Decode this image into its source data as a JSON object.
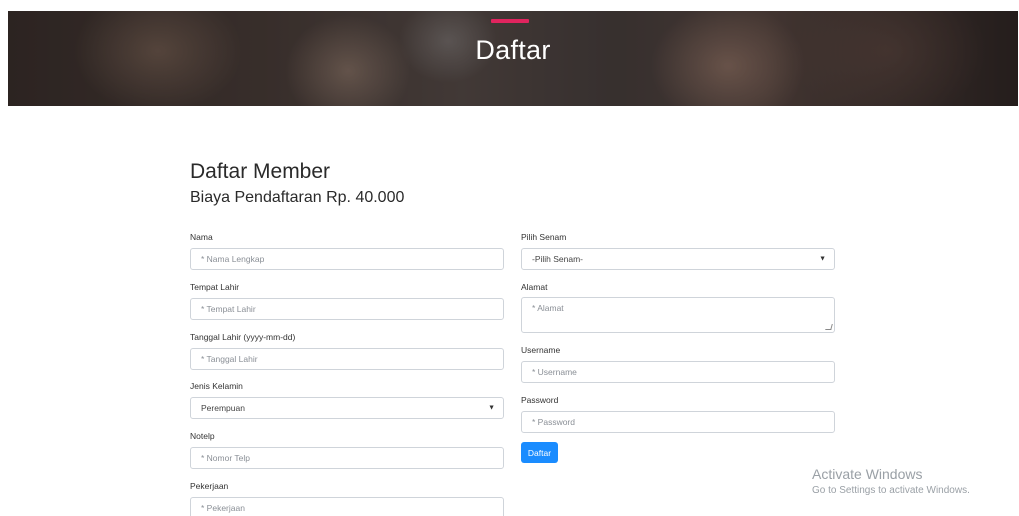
{
  "hero": {
    "title": "Daftar",
    "accent_color": "#e0245e"
  },
  "form": {
    "title": "Daftar Member",
    "subtitle": "Biaya Pendaftaran Rp. 40.000",
    "left_fields": {
      "nama": {
        "label": "Nama",
        "placeholder": "* Nama Lengkap"
      },
      "tempat_lahir": {
        "label": "Tempat Lahir",
        "placeholder": "* Tempat Lahir"
      },
      "tanggal_lahir": {
        "label": "Tanggal Lahir (yyyy-mm-dd)",
        "placeholder": "* Tanggal Lahir"
      },
      "jenis_kelamin": {
        "label": "Jenis Kelamin",
        "value": "Perempuan"
      },
      "notelp": {
        "label": "Notelp",
        "placeholder": "* Nomor Telp"
      },
      "pekerjaan": {
        "label": "Pekerjaan",
        "placeholder": "* Pekerjaan"
      }
    },
    "right_fields": {
      "senam": {
        "label": "Pilih Senam",
        "value": "-Pilih Senam-"
      },
      "alamat": {
        "label": "Alamat",
        "placeholder": "* Alamat"
      },
      "username": {
        "label": "Username",
        "placeholder": "* Username"
      },
      "password": {
        "label": "Password",
        "placeholder": "* Password"
      }
    },
    "submit_label": "Daftar",
    "button_color": "#1a8cff"
  },
  "watermark": {
    "title": "Activate Windows",
    "subtitle": "Go to Settings to activate Windows."
  }
}
